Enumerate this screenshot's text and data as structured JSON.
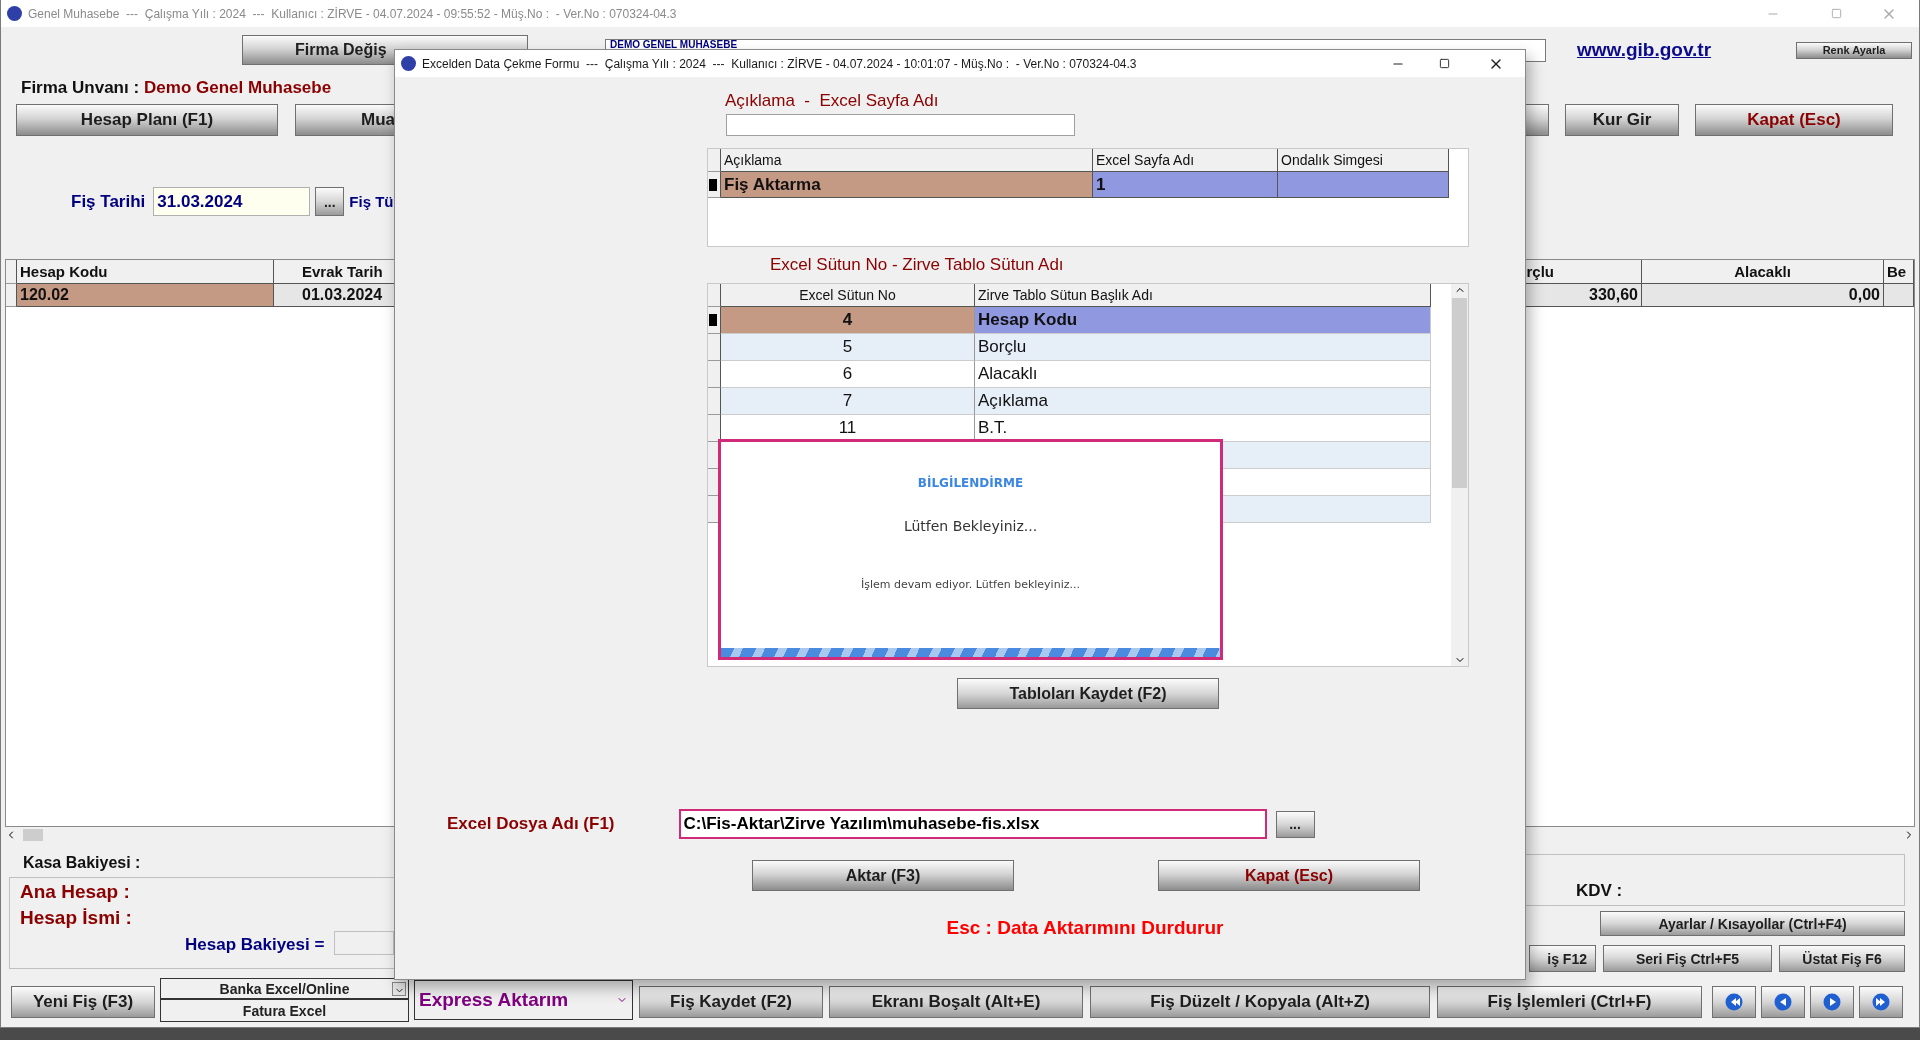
{
  "main_window": {
    "title": "Genel Muhasebe  ---  Çalışma Yılı : 2024  ---  Kullanıcı : ZİRVE - 04.07.2024 - 09:55:52 - Müş.No :  - Ver.No : 070324-04.3",
    "company_button": "Firma Değiş",
    "company_combo": "DEMO  GENEL  MUHASEBE",
    "link": "www.gib.gov.tr",
    "color_button": "Renk Ayarla",
    "company_label": "Firma Unvanı :",
    "company_name": "Demo Genel Muhasebe",
    "left_buttons": [
      "Hesap Planı (F1)",
      "Mua"
    ],
    "right_buttons": [
      {
        "label": "Kur Gir",
        "kind": "normal"
      },
      {
        "label": "Kapat (Esc)",
        "kind": "danger"
      }
    ],
    "date_label": "Fiş Tarihi",
    "date_value": "31.03.2024",
    "date_button": "...",
    "type_label": "Fiş Tü",
    "grid": {
      "columns": [
        "Hesap Kodu",
        "Evrak Tarih",
        "rçlu",
        "Alacaklı",
        "Be"
      ],
      "rows": [
        {
          "selected": true,
          "cells": [
            "120.02",
            "01.03.2024",
            "330,60",
            "0,00"
          ]
        }
      ]
    },
    "cash_balance": "Kasa Bakiyesi :",
    "main_account": "Ana Hesap :",
    "account_name": "Hesap İsmi :",
    "account_balance": "Hesap Bakiyesi =",
    "vat": "KDV :",
    "settings_button": "Ayarlar / Kısayollar (Ctrl+F4)",
    "voucher_buttons": [
      "iş F12",
      "Seri Fiş Ctrl+F5",
      "Üstat Fiş F6"
    ],
    "new_button": "Yeni Fiş (F3)",
    "excel_menu": [
      "Banka Excel/Online",
      "Fatura Excel"
    ],
    "express_combo": "Express Aktarım",
    "bottom_buttons": [
      "Fiş Kaydet (F2)",
      "Ekranı Boşalt (Alt+E)",
      "Fiş Düzelt / Kopyala (Alt+Z)",
      "Fiş İşlemleri (Ctrl+F)"
    ],
    "nav_buttons": [
      {
        "kind": "first"
      },
      {
        "kind": "prev"
      },
      {
        "kind": "next"
      },
      {
        "kind": "last"
      }
    ]
  },
  "dialog": {
    "title": "Excelden Data Çekme Formu  ---  Çalışma Yılı : 2024  ---  Kullanıcı : ZİRVE - 04.07.2024 - 10:01:07 - Müş.No :  - Ver.No : 070324-04.3",
    "sheet_label": "Açıklama  -  Excel Sayfa Adı",
    "sheet_grid": {
      "columns": [
        "Açıklama",
        "Excel Sayfa Adı",
        "Ondalık Simgesi"
      ],
      "rows": [
        {
          "selected": true,
          "cells": [
            "Fiş Aktarma",
            "1"
          ]
        }
      ]
    },
    "column_label": "Excel Sütun No - Zirve Tablo Sütun Adı",
    "column_grid": {
      "columns": [
        "Excel Sütun No",
        "Zirve Tablo Sütun Başlık Adı"
      ],
      "rows": [
        {
          "selected": true,
          "cells": [
            "4",
            "Hesap Kodu"
          ]
        },
        {
          "selected": false,
          "cells": [
            "5",
            "Borçlu"
          ]
        },
        {
          "selected": false,
          "cells": [
            "6",
            "Alacaklı"
          ]
        },
        {
          "selected": false,
          "cells": [
            "7",
            "Açıklama"
          ]
        },
        {
          "selected": false,
          "cells": [
            "11",
            "B.T."
          ]
        }
      ]
    },
    "popup": {
      "title": "BİLGİLENDİRME",
      "message": "Lütfen Bekleyiniz...",
      "detail": "İşlem devam ediyor. Lütfen bekleyiniz...",
      "level": 1
    },
    "save_button": "Tabloları Kaydet (F2)",
    "file_label": "Excel Dosya Adı (F1)",
    "file_value": "C:\\Fis-Aktar\\Zirve Yazılım\\muhasebe-fis.xlsx",
    "browse_button": "...",
    "buttons": [
      {
        "label": "Aktar (F3)",
        "kind": "normal"
      },
      {
        "label": "Kapat (Esc)",
        "kind": "danger"
      }
    ],
    "hint": "Esc : Data Aktarımını Durdurur"
  }
}
